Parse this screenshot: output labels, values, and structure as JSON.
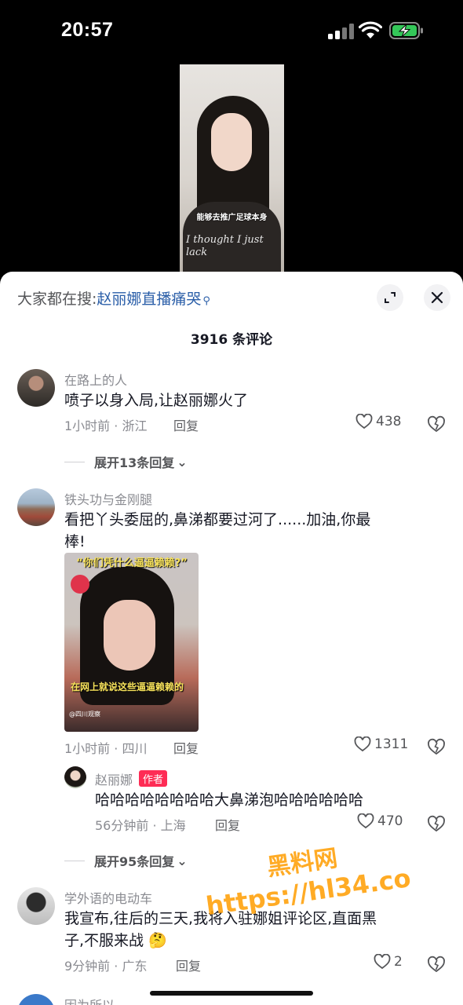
{
  "status_bar": {
    "time": "20:57"
  },
  "video": {
    "caption": "能够去推广足球本身",
    "shirt_text": "I thought I just lack"
  },
  "header": {
    "search_prefix": "大家都在搜:",
    "search_link": "赵丽娜直播痛哭",
    "search_icon": "search-icon",
    "expand_icon": "expand-icon",
    "close_icon": "close-icon"
  },
  "comment_count_title": "3916 条评论",
  "comments": [
    {
      "name": "在路上的人",
      "text": "喷子以身入局,让赵丽娜火了",
      "meta": "1小时前 · 浙江",
      "reply": "回复",
      "likes": "438",
      "expand": "展开13条回复"
    },
    {
      "name": "铁头功与金刚腿",
      "text_line1": "看把丫头委屈的,鼻涕都要过河了......加油,你最",
      "text_line2": "棒!",
      "image": {
        "banner": "“你们凭什么逼逼赖赖?”",
        "subtitle": "在网上就说这些逼逼赖赖的",
        "source": "@四川观察"
      },
      "meta": "1小时前 · 四川",
      "reply": "回复",
      "likes": "1311",
      "sub_reply": {
        "name": "赵丽娜",
        "tag": "作者",
        "text": "哈哈哈哈哈哈哈哈大鼻涕泡哈哈哈哈哈哈",
        "meta": "56分钟前 · 上海",
        "reply": "回复",
        "likes": "470"
      },
      "expand": "展开95条回复"
    },
    {
      "name": "学外语的电动车",
      "text_line1": "我宣布,往后的三天,我将入驻娜姐评论区,直面黑",
      "text_line2": "子,不服来战",
      "emoji": "🤔",
      "meta": "9分钟前 · 广东",
      "reply": "回复",
      "likes": "2"
    },
    {
      "name": "因为所以"
    }
  ],
  "watermark": {
    "line1": "黑料网",
    "line2": "https://hl34.co"
  },
  "colors": {
    "link": "#2a5ea8",
    "author_tag": "#fe2c55",
    "watermark": "#ff9d00"
  }
}
